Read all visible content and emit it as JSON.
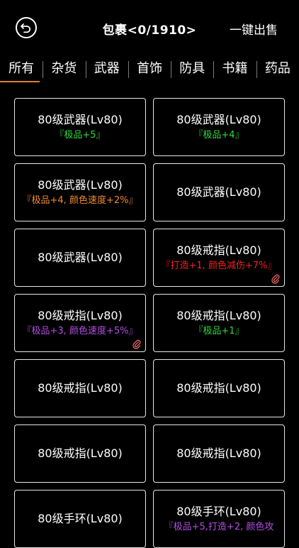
{
  "header": {
    "title": "包裹<0/1910>",
    "sell_label": "一键出售",
    "back_icon": "back-arrow-icon"
  },
  "colors": {
    "green": "#2fdb3a",
    "orange": "#f28a30",
    "purple": "#b44ee6",
    "red": "#f02323",
    "clip": "#ff6a6a",
    "tab_underline": "#d9823b"
  },
  "tabs": [
    {
      "label": "所有",
      "active": true
    },
    {
      "label": "杂货",
      "active": false
    },
    {
      "label": "武器",
      "active": false
    },
    {
      "label": "首饰",
      "active": false
    },
    {
      "label": "防具",
      "active": false
    },
    {
      "label": "书籍",
      "active": false
    },
    {
      "label": "药品",
      "active": false
    }
  ],
  "items": [
    {
      "name": "80级武器(Lv80)",
      "attr": "『极品+5』",
      "attr_color": "green",
      "clip": false
    },
    {
      "name": "80级武器(Lv80)",
      "attr": "『极品+4』",
      "attr_color": "green",
      "clip": false
    },
    {
      "name": "80级武器(Lv80)",
      "attr": "『极品+4, 颜色速度+2%』",
      "attr_color": "orange",
      "clip": false
    },
    {
      "name": "80级武器(Lv80)",
      "attr": "",
      "attr_color": "",
      "clip": false
    },
    {
      "name": "80级武器(Lv80)",
      "attr": "",
      "attr_color": "",
      "clip": false
    },
    {
      "name": "80级戒指(Lv80)",
      "attr": "『打造+1, 颜色减伤+7%』",
      "attr_color": "red",
      "clip": true
    },
    {
      "name": "80级戒指(Lv80)",
      "attr": "『极品+3, 颜色速度+5%』",
      "attr_color": "purple",
      "clip": true
    },
    {
      "name": "80级戒指(Lv80)",
      "attr": "『极品+1』",
      "attr_color": "green",
      "clip": false
    },
    {
      "name": "80级戒指(Lv80)",
      "attr": "",
      "attr_color": "",
      "clip": false
    },
    {
      "name": "80级戒指(Lv80)",
      "attr": "",
      "attr_color": "",
      "clip": false
    },
    {
      "name": "80级戒指(Lv80)",
      "attr": "",
      "attr_color": "",
      "clip": false
    },
    {
      "name": "80级戒指(Lv80)",
      "attr": "",
      "attr_color": "",
      "clip": false
    },
    {
      "name": "80级手环(Lv80)",
      "attr": "",
      "attr_color": "",
      "clip": false
    },
    {
      "name": "80级手环(Lv80)",
      "attr": "『极品+5,打造+2, 颜色攻",
      "attr_color": "purple",
      "clip": false
    }
  ]
}
